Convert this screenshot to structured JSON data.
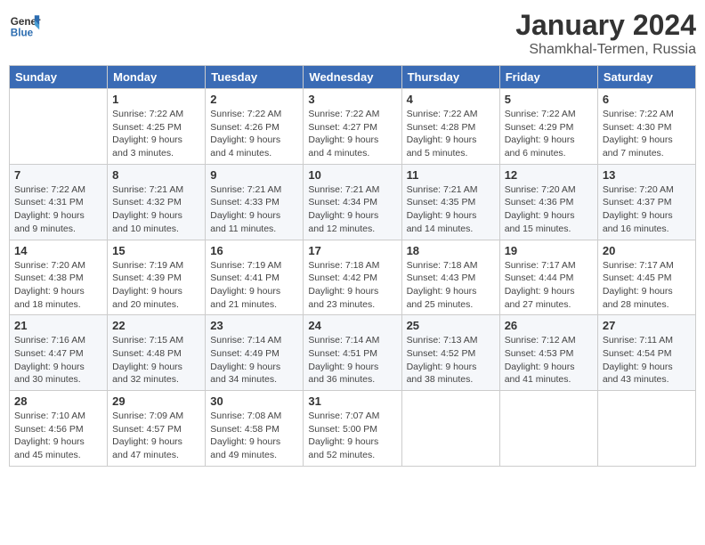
{
  "header": {
    "logo_general": "General",
    "logo_blue": "Blue",
    "title": "January 2024",
    "location": "Shamkhal-Termen, Russia"
  },
  "days_of_week": [
    "Sunday",
    "Monday",
    "Tuesday",
    "Wednesday",
    "Thursday",
    "Friday",
    "Saturday"
  ],
  "weeks": [
    [
      {
        "day": "",
        "info": ""
      },
      {
        "day": "1",
        "info": "Sunrise: 7:22 AM\nSunset: 4:25 PM\nDaylight: 9 hours\nand 3 minutes."
      },
      {
        "day": "2",
        "info": "Sunrise: 7:22 AM\nSunset: 4:26 PM\nDaylight: 9 hours\nand 4 minutes."
      },
      {
        "day": "3",
        "info": "Sunrise: 7:22 AM\nSunset: 4:27 PM\nDaylight: 9 hours\nand 4 minutes."
      },
      {
        "day": "4",
        "info": "Sunrise: 7:22 AM\nSunset: 4:28 PM\nDaylight: 9 hours\nand 5 minutes."
      },
      {
        "day": "5",
        "info": "Sunrise: 7:22 AM\nSunset: 4:29 PM\nDaylight: 9 hours\nand 6 minutes."
      },
      {
        "day": "6",
        "info": "Sunrise: 7:22 AM\nSunset: 4:30 PM\nDaylight: 9 hours\nand 7 minutes."
      }
    ],
    [
      {
        "day": "7",
        "info": "Sunrise: 7:22 AM\nSunset: 4:31 PM\nDaylight: 9 hours\nand 9 minutes."
      },
      {
        "day": "8",
        "info": "Sunrise: 7:21 AM\nSunset: 4:32 PM\nDaylight: 9 hours\nand 10 minutes."
      },
      {
        "day": "9",
        "info": "Sunrise: 7:21 AM\nSunset: 4:33 PM\nDaylight: 9 hours\nand 11 minutes."
      },
      {
        "day": "10",
        "info": "Sunrise: 7:21 AM\nSunset: 4:34 PM\nDaylight: 9 hours\nand 12 minutes."
      },
      {
        "day": "11",
        "info": "Sunrise: 7:21 AM\nSunset: 4:35 PM\nDaylight: 9 hours\nand 14 minutes."
      },
      {
        "day": "12",
        "info": "Sunrise: 7:20 AM\nSunset: 4:36 PM\nDaylight: 9 hours\nand 15 minutes."
      },
      {
        "day": "13",
        "info": "Sunrise: 7:20 AM\nSunset: 4:37 PM\nDaylight: 9 hours\nand 16 minutes."
      }
    ],
    [
      {
        "day": "14",
        "info": "Sunrise: 7:20 AM\nSunset: 4:38 PM\nDaylight: 9 hours\nand 18 minutes."
      },
      {
        "day": "15",
        "info": "Sunrise: 7:19 AM\nSunset: 4:39 PM\nDaylight: 9 hours\nand 20 minutes."
      },
      {
        "day": "16",
        "info": "Sunrise: 7:19 AM\nSunset: 4:41 PM\nDaylight: 9 hours\nand 21 minutes."
      },
      {
        "day": "17",
        "info": "Sunrise: 7:18 AM\nSunset: 4:42 PM\nDaylight: 9 hours\nand 23 minutes."
      },
      {
        "day": "18",
        "info": "Sunrise: 7:18 AM\nSunset: 4:43 PM\nDaylight: 9 hours\nand 25 minutes."
      },
      {
        "day": "19",
        "info": "Sunrise: 7:17 AM\nSunset: 4:44 PM\nDaylight: 9 hours\nand 27 minutes."
      },
      {
        "day": "20",
        "info": "Sunrise: 7:17 AM\nSunset: 4:45 PM\nDaylight: 9 hours\nand 28 minutes."
      }
    ],
    [
      {
        "day": "21",
        "info": "Sunrise: 7:16 AM\nSunset: 4:47 PM\nDaylight: 9 hours\nand 30 minutes."
      },
      {
        "day": "22",
        "info": "Sunrise: 7:15 AM\nSunset: 4:48 PM\nDaylight: 9 hours\nand 32 minutes."
      },
      {
        "day": "23",
        "info": "Sunrise: 7:14 AM\nSunset: 4:49 PM\nDaylight: 9 hours\nand 34 minutes."
      },
      {
        "day": "24",
        "info": "Sunrise: 7:14 AM\nSunset: 4:51 PM\nDaylight: 9 hours\nand 36 minutes."
      },
      {
        "day": "25",
        "info": "Sunrise: 7:13 AM\nSunset: 4:52 PM\nDaylight: 9 hours\nand 38 minutes."
      },
      {
        "day": "26",
        "info": "Sunrise: 7:12 AM\nSunset: 4:53 PM\nDaylight: 9 hours\nand 41 minutes."
      },
      {
        "day": "27",
        "info": "Sunrise: 7:11 AM\nSunset: 4:54 PM\nDaylight: 9 hours\nand 43 minutes."
      }
    ],
    [
      {
        "day": "28",
        "info": "Sunrise: 7:10 AM\nSunset: 4:56 PM\nDaylight: 9 hours\nand 45 minutes."
      },
      {
        "day": "29",
        "info": "Sunrise: 7:09 AM\nSunset: 4:57 PM\nDaylight: 9 hours\nand 47 minutes."
      },
      {
        "day": "30",
        "info": "Sunrise: 7:08 AM\nSunset: 4:58 PM\nDaylight: 9 hours\nand 49 minutes."
      },
      {
        "day": "31",
        "info": "Sunrise: 7:07 AM\nSunset: 5:00 PM\nDaylight: 9 hours\nand 52 minutes."
      },
      {
        "day": "",
        "info": ""
      },
      {
        "day": "",
        "info": ""
      },
      {
        "day": "",
        "info": ""
      }
    ]
  ]
}
